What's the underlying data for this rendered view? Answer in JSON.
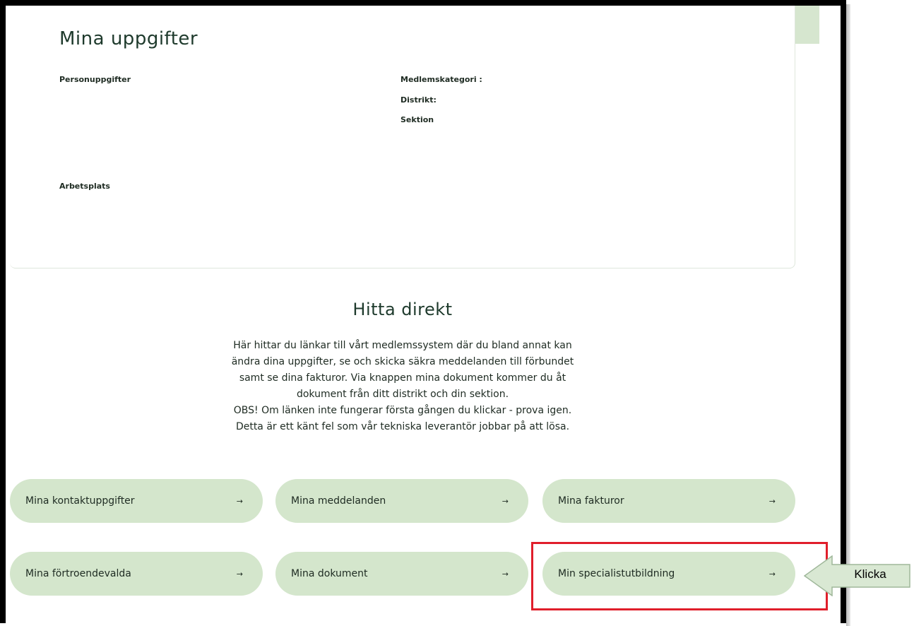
{
  "profile": {
    "title": "Mina uppgifter",
    "labels": {
      "personal": "Personuppgifter",
      "member_category": "Medlemskategori :",
      "district": "Distrikt:",
      "section": "Sektion",
      "workplace": "Arbetsplats"
    }
  },
  "find": {
    "title": "Hitta direkt",
    "description_lines": [
      "Här hittar du länkar till vårt medlemssystem där du bland annat kan",
      "ändra dina uppgifter, se och skicka säkra meddelanden till förbundet",
      "samt se dina fakturor. Via knappen mina dokument kommer du åt",
      "dokument från ditt distrikt och din sektion.",
      "OBS! Om länken inte fungerar första gången du klickar - prova igen.",
      "Detta är ett känt fel som vår tekniska leverantör jobbar på att lösa."
    ]
  },
  "buttons": [
    {
      "label": "Mina kontaktuppgifter",
      "arrow": "→"
    },
    {
      "label": "Mina meddelanden",
      "arrow": "→"
    },
    {
      "label": "Mina fakturor",
      "arrow": "→"
    },
    {
      "label": "Mina förtroendevalda",
      "arrow": "→"
    },
    {
      "label": "Mina dokument",
      "arrow": "→"
    },
    {
      "label": "Min specialistutbildning",
      "arrow": "→"
    }
  ],
  "annotation": {
    "callout_text": "Klicka",
    "highlight_color": "#e01e2b",
    "arrow_fill": "#d9e8d3",
    "arrow_stroke": "#9fb79a"
  },
  "colors": {
    "button_bg": "#d4e6cc",
    "heading": "#1e3a2c"
  }
}
